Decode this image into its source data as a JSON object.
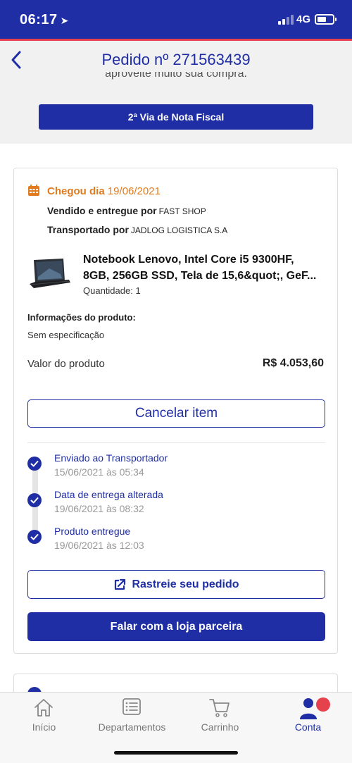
{
  "status_bar": {
    "time": "06:17",
    "network": "4G"
  },
  "header": {
    "title": "Pedido nº 271563439",
    "clipped_text": "aproveite muito sua compra."
  },
  "invoice_button": "2ª Via de Nota Fiscal",
  "order": {
    "arrived_prefix": "Chegou dia",
    "arrived_date": "19/06/2021",
    "sold_by_label": "Vendido e entregue por",
    "sold_by_value": "FAST SHOP",
    "shipped_by_label": "Transportado por",
    "shipped_by_value": "JADLOG LOGISTICA S.A",
    "product_name_line1": "Notebook Lenovo, Intel Core i5 9300HF,",
    "product_name_line2": "8GB, 256GB SSD, Tela de 15,6&quot;, GeF...",
    "quantity": "Quantidade: 1",
    "info_label": "Informações do produto:",
    "info_value": "Sem especificação",
    "price_label": "Valor do produto",
    "price_value": "R$ 4.053,60",
    "cancel_label": "Cancelar item",
    "steps": [
      {
        "title": "Enviado ao Transportador",
        "date": "15/06/2021 às 05:34"
      },
      {
        "title": "Data de entrega alterada",
        "date": "19/06/2021 às 08:32"
      },
      {
        "title": "Produto entregue",
        "date": "19/06/2021 às 12:03"
      }
    ],
    "track_label": "Rastreie seu pedido",
    "contact_label": "Falar com a loja parceira"
  },
  "tabs": [
    {
      "label": "Início",
      "icon": "home-icon"
    },
    {
      "label": "Departamentos",
      "icon": "list-icon"
    },
    {
      "label": "Carrinho",
      "icon": "cart-icon"
    },
    {
      "label": "Conta",
      "icon": "account-icon"
    }
  ],
  "colors": {
    "primary": "#1f2ea5",
    "accent": "#e5424d",
    "arrived": "#e07b1f"
  }
}
